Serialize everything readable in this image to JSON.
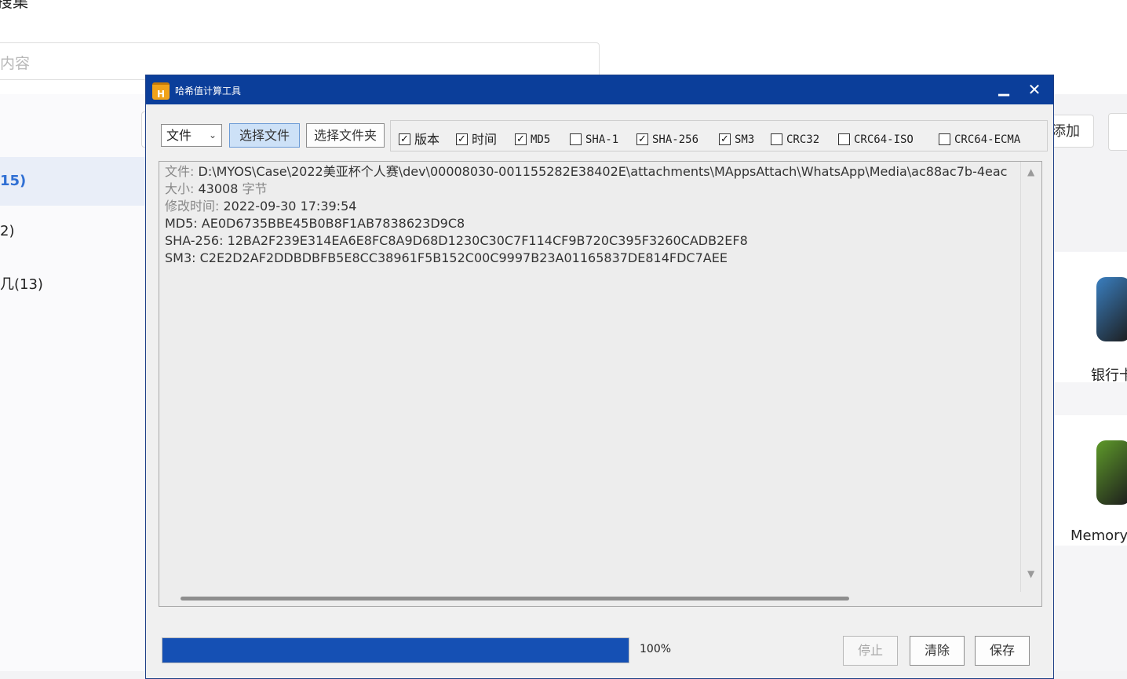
{
  "background": {
    "title_fragment": "搜集",
    "search_placeholder": "内容",
    "sidebar_items": [
      {
        "label": "15)",
        "active": true
      },
      {
        "label": "2)",
        "active": false
      },
      {
        "label": "几(13)",
        "active": false
      }
    ],
    "add_button": "添加",
    "cards": [
      {
        "label": "银行卡",
        "icon": "bank-card-app-icon",
        "color": "#3a7fc0"
      },
      {
        "label": "Memory",
        "icon": "memory-chip-app-icon",
        "color": "#5e9a2a"
      }
    ]
  },
  "window": {
    "title": "哈希值计算工具",
    "app_icon_letter": "H",
    "minimize_glyph": "▁",
    "close_glyph": "✕",
    "mode_select": "文件",
    "buttons": {
      "select_file": "选择文件",
      "select_folder": "选择文件夹",
      "stop": "停止",
      "clear": "清除",
      "save": "保存"
    },
    "options": [
      {
        "label": "版本",
        "checked": true
      },
      {
        "label": "时间",
        "checked": true
      },
      {
        "label": "MD5",
        "checked": true
      },
      {
        "label": "SHA-1",
        "checked": false
      },
      {
        "label": "SHA-256",
        "checked": true
      },
      {
        "label": "SM3",
        "checked": true
      },
      {
        "label": "CRC32",
        "checked": false
      },
      {
        "label": "CRC64-ISO",
        "checked": false
      },
      {
        "label": "CRC64-ECMA",
        "checked": false
      }
    ],
    "output": {
      "file_key": "文件:",
      "file_value": " D:\\MYOS\\Case\\2022美亚杯个人赛\\dev\\00008030-001155282E38402E\\attachments\\MAppsAttach\\WhatsApp\\Media\\ac88ac7b-4eac",
      "size_key": "大小:",
      "size_value": " 43008 ",
      "size_unit": "字节",
      "mtime_key": "修改时间:",
      "mtime_value": " 2022-09-30 17:39:54",
      "md5": "MD5: AE0D6735BBE45B0B8F1AB7838623D9C8",
      "sha256": "SHA-256: 12BA2F239E314EA6E8FC8A9D68D1230C30C7F114CF9B720C395F3260CADB2EF8",
      "sm3": "SM3: C2E2D2AF2DDBDBFB5E8CC38961F5B152C00C9997B23A01165837DE814FDC7AEE"
    },
    "progress": {
      "percent": 100,
      "label": "100%"
    },
    "colors": {
      "titlebar": "#0b3e9a",
      "progress": "#1550b4"
    }
  }
}
